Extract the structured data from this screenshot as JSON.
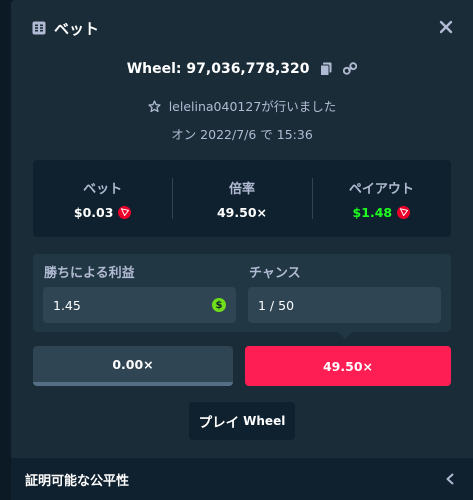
{
  "modal": {
    "title": "ベット",
    "title_icon": "receipt-icon",
    "close_icon": "close-icon"
  },
  "bet_info": {
    "game_label": "Wheel: 97,036,778,320",
    "user_text": "lelelina040127が行いました",
    "date_text": "オン 2022/7/6 で 15:36"
  },
  "stats": {
    "bet_label": "ベット",
    "bet_value": "$0.03",
    "multiplier_label": "倍率",
    "multiplier_value": "49.50×",
    "payout_label": "ペイアウト",
    "payout_value": "$1.48"
  },
  "fields": {
    "profit_label": "勝ちによる利益",
    "profit_value": "1.45",
    "chance_label": "チャンス",
    "chance_value": "1 / 50"
  },
  "segments": {
    "left_label": "0.00×",
    "right_label": "49.50×"
  },
  "play_button": {
    "main": "プレイ",
    "sub": "Wheel"
  },
  "footer": {
    "title": "証明可能な公平性"
  },
  "colors": {
    "modal_bg": "#1a2c38",
    "dark_bg": "#0f212e",
    "panel_bg": "#213743",
    "input_bg": "#2f4553",
    "accent_red": "#ff1e53",
    "payout_green": "#1fff20",
    "muted_text": "#b1bad3",
    "coin_red": "#eb0029"
  }
}
